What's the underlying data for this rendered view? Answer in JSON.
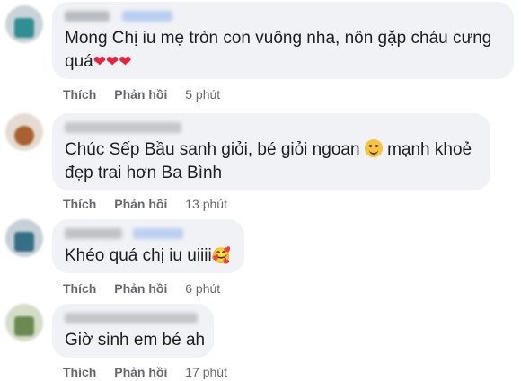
{
  "comments": [
    {
      "text_line1": "Mong Chị iu mẹ tròn con vuông nha, nôn gặp cháu cưng",
      "text_line2": "quá",
      "emoji": "❤❤❤",
      "actions": {
        "like": "Thích",
        "reply": "Phản hồi",
        "time": "5 phút"
      }
    },
    {
      "text_line1": "Chúc Sếp Bầu sanh giỏi, bé giỏi ngoan",
      "text_line1b": "mạnh khoẻ",
      "text_line2": "đẹp trai hơn Ba Bình",
      "emoji": "smiley-icon",
      "actions": {
        "like": "Thích",
        "reply": "Phản hồi",
        "time": "13 phút"
      }
    },
    {
      "text_line1": "Khéo quá chị iu uiiii",
      "emoji": "🥰",
      "actions": {
        "like": "Thích",
        "reply": "Phản hồi",
        "time": "6 phút"
      }
    },
    {
      "text_line1": "Giờ sinh em bé ah",
      "actions": {
        "like": "Thích",
        "reply": "Phản hồi",
        "time": "17 phút"
      }
    }
  ],
  "colors": {
    "bubble": "#f0f2f5",
    "text": "#1c1e21",
    "meta": "#65676b",
    "heart": "#e8233c"
  }
}
